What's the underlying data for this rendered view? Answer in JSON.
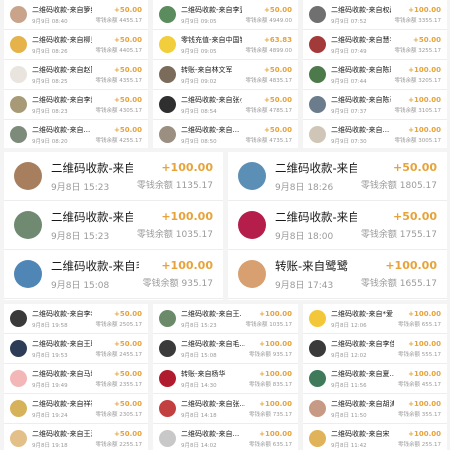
{
  "panels": [
    {
      "rows": [
        {
          "title": "二维码收款-来自箩纯",
          "date": "9月9日 08:40",
          "amount": "+50.00",
          "balance": "零钱余额 4455.17",
          "color": "#c9a48a"
        },
        {
          "title": "二维码收款-来自柳贝",
          "date": "9月9日 08:26",
          "amount": "+50.00",
          "balance": "零钱余额 4405.17",
          "color": "#e6b24a"
        },
        {
          "title": "二维码收款-来自赵陈陈",
          "date": "9月9日 08:25",
          "amount": "+50.00",
          "balance": "零钱余额 4355.17",
          "color": "#e9e4de"
        },
        {
          "title": "二维码收款-来自李焕焕",
          "date": "9月9日 08:23",
          "amount": "+50.00",
          "balance": "零钱余额 4305.17",
          "color": "#a89a76"
        },
        {
          "title": "二维码收款-来自...",
          "date": "9月9日 08:20",
          "amount": "+50.00",
          "balance": "零钱余额 4255.17",
          "color": "#7d8b7a"
        }
      ]
    },
    {
      "rows": [
        {
          "title": "二维码收款-来自李壹胜",
          "date": "9月9日 09:05",
          "amount": "+50.00",
          "balance": "零钱余额 4949.00",
          "color": "#5b8c5e"
        },
        {
          "title": "零钱充值-来自中国银...",
          "date": "9月9日 09:05",
          "amount": "+63.83",
          "balance": "零钱余额 4899.00",
          "color": "#f2cd3c"
        },
        {
          "title": "转账-来自林文军",
          "date": "9月9日 09:02",
          "amount": "+50.00",
          "balance": "零钱余额 4835.17",
          "color": "#7b6b5a"
        },
        {
          "title": "二维码收款-来自张小伍",
          "date": "9月9日 08:54",
          "amount": "+50.00",
          "balance": "零钱余额 4785.17",
          "color": "#2f2f2f"
        },
        {
          "title": "二维码收款-来自...",
          "date": "9月9日 08:50",
          "amount": "+50.00",
          "balance": "零钱余额 4735.17",
          "color": "#9a8f80"
        }
      ]
    },
    {
      "rows": [
        {
          "title": "二维码收款-来自权磊",
          "date": "9月9日 07:52",
          "amount": "+100.00",
          "balance": "零钱余额 3355.17",
          "color": "#707070"
        },
        {
          "title": "二维码收款-来自慧华",
          "date": "9月9日 07:49",
          "amount": "+50.00",
          "balance": "零钱余额 3255.17",
          "color": "#a33a3a"
        },
        {
          "title": "二维码收款-来自陈瑜",
          "date": "9月9日 07:44",
          "amount": "+100.00",
          "balance": "零钱余额 3205.17",
          "color": "#4d7a4a"
        },
        {
          "title": "二维码收款-来自陈表周",
          "date": "9月9日 07:37",
          "amount": "+100.00",
          "balance": "零钱余额 3105.17",
          "color": "#6b7c8c"
        },
        {
          "title": "二维码收款-来自...",
          "date": "9月9日 07:30",
          "amount": "+100.00",
          "balance": "零钱余额 3005.17",
          "color": "#cfc6b8"
        }
      ]
    },
    {
      "rows": [
        {
          "title": "二维码收款-来自冰心",
          "date": "9月8日 15:23",
          "amount": "+100.00",
          "balance": "零钱余额 1135.17",
          "color": "#a87f5e"
        },
        {
          "title": "二维码收款-来自王...",
          "date": "9月8日 15:23",
          "amount": "+100.00",
          "balance": "零钱余额 1035.17",
          "color": "#6f8a70"
        },
        {
          "title": "二维码收款-来自毛...",
          "date": "9月8日 15:08",
          "amount": "+100.00",
          "balance": "零钱余额 935.17",
          "color": "#4f86b6"
        }
      ]
    },
    {
      "rows": [
        {
          "title": "二维码收款-来自周劲松",
          "date": "9月8日 18:26",
          "amount": "+50.00",
          "balance": "零钱余额 1805.17",
          "color": "#5b8fb5"
        },
        {
          "title": "二维码收款-来自苏...",
          "date": "9月8日 18:00",
          "amount": "+50.00",
          "balance": "零钱余额 1755.17",
          "color": "#b51e4a"
        },
        {
          "title": "转账-来自鹭鹭",
          "date": "9月8日 17:43",
          "amount": "+100.00",
          "balance": "零钱余额 1655.17",
          "color": "#d8a070"
        }
      ]
    },
    {
      "rows": [
        {
          "title": "二维码收款-来自李孝梁",
          "date": "9月8日 19:58",
          "amount": "+50.00",
          "balance": "零钱余额 2505.17",
          "color": "#3a3a3a"
        },
        {
          "title": "二维码收款-来自王聪",
          "date": "9月8日 19:53",
          "amount": "+50.00",
          "balance": "零钱余额 2455.17",
          "color": "#2d3d58"
        },
        {
          "title": "二维码收款-来自马堀",
          "date": "9月8日 19:49",
          "amount": "+50.00",
          "balance": "零钱余额 2355.17",
          "color": "#f3b7b7"
        },
        {
          "title": "二维码收款-来自祥祥钰",
          "date": "9月8日 19:24",
          "amount": "+50.00",
          "balance": "零钱余额 2305.17",
          "color": "#d6b25a"
        },
        {
          "title": "二维码收款-来自王活",
          "date": "9月8日 19:18",
          "amount": "+50.00",
          "balance": "零钱余额 2255.17",
          "color": "#e3c089"
        }
      ]
    },
    {
      "rows": [
        {
          "title": "二维码收款-来自王...",
          "date": "9月8日 15:23",
          "amount": "+100.00",
          "balance": "零钱余额 1035.17",
          "color": "#6a8a6a"
        },
        {
          "title": "二维码收款-来自毛...",
          "date": "9月8日 15:08",
          "amount": "+100.00",
          "balance": "零钱余额 935.17",
          "color": "#3b3b3b"
        },
        {
          "title": "转账-来自杨华",
          "date": "9月8日 14:30",
          "amount": "+100.00",
          "balance": "零钱余额 835.17",
          "color": "#b01c2e"
        },
        {
          "title": "二维码收款-来自张...",
          "date": "9月8日 14:18",
          "amount": "+100.00",
          "balance": "零钱余额 735.17",
          "color": "#c24040"
        },
        {
          "title": "二维码收款-来自...",
          "date": "9月8日 14:02",
          "amount": "+100.00",
          "balance": "零钱余额 635.17",
          "color": "#c8c8c8"
        }
      ]
    },
    {
      "rows": [
        {
          "title": "二维码收款-来自*爱",
          "date": "9月8日 12:06",
          "amount": "+100.00",
          "balance": "零钱余额 655.17",
          "color": "#f3c73a"
        },
        {
          "title": "二维码收款-来自李佳颖",
          "date": "9月8日 12:02",
          "amount": "+100.00",
          "balance": "零钱余额 555.17",
          "color": "#3a3a3a"
        },
        {
          "title": "二维码收款-来自夏...",
          "date": "9月8日 11:56",
          "amount": "+100.00",
          "balance": "零钱余额 455.17",
          "color": "#3f7a5a"
        },
        {
          "title": "二维码收款-来自胡涛",
          "date": "9月8日 11:50",
          "amount": "+100.00",
          "balance": "零钱余额 355.17",
          "color": "#c79a86"
        },
        {
          "title": "二维码收款-来自宋",
          "date": "9月8日 11:42",
          "amount": "+100.00",
          "balance": "零钱余额 255.17",
          "color": "#e0b35a"
        }
      ]
    }
  ]
}
